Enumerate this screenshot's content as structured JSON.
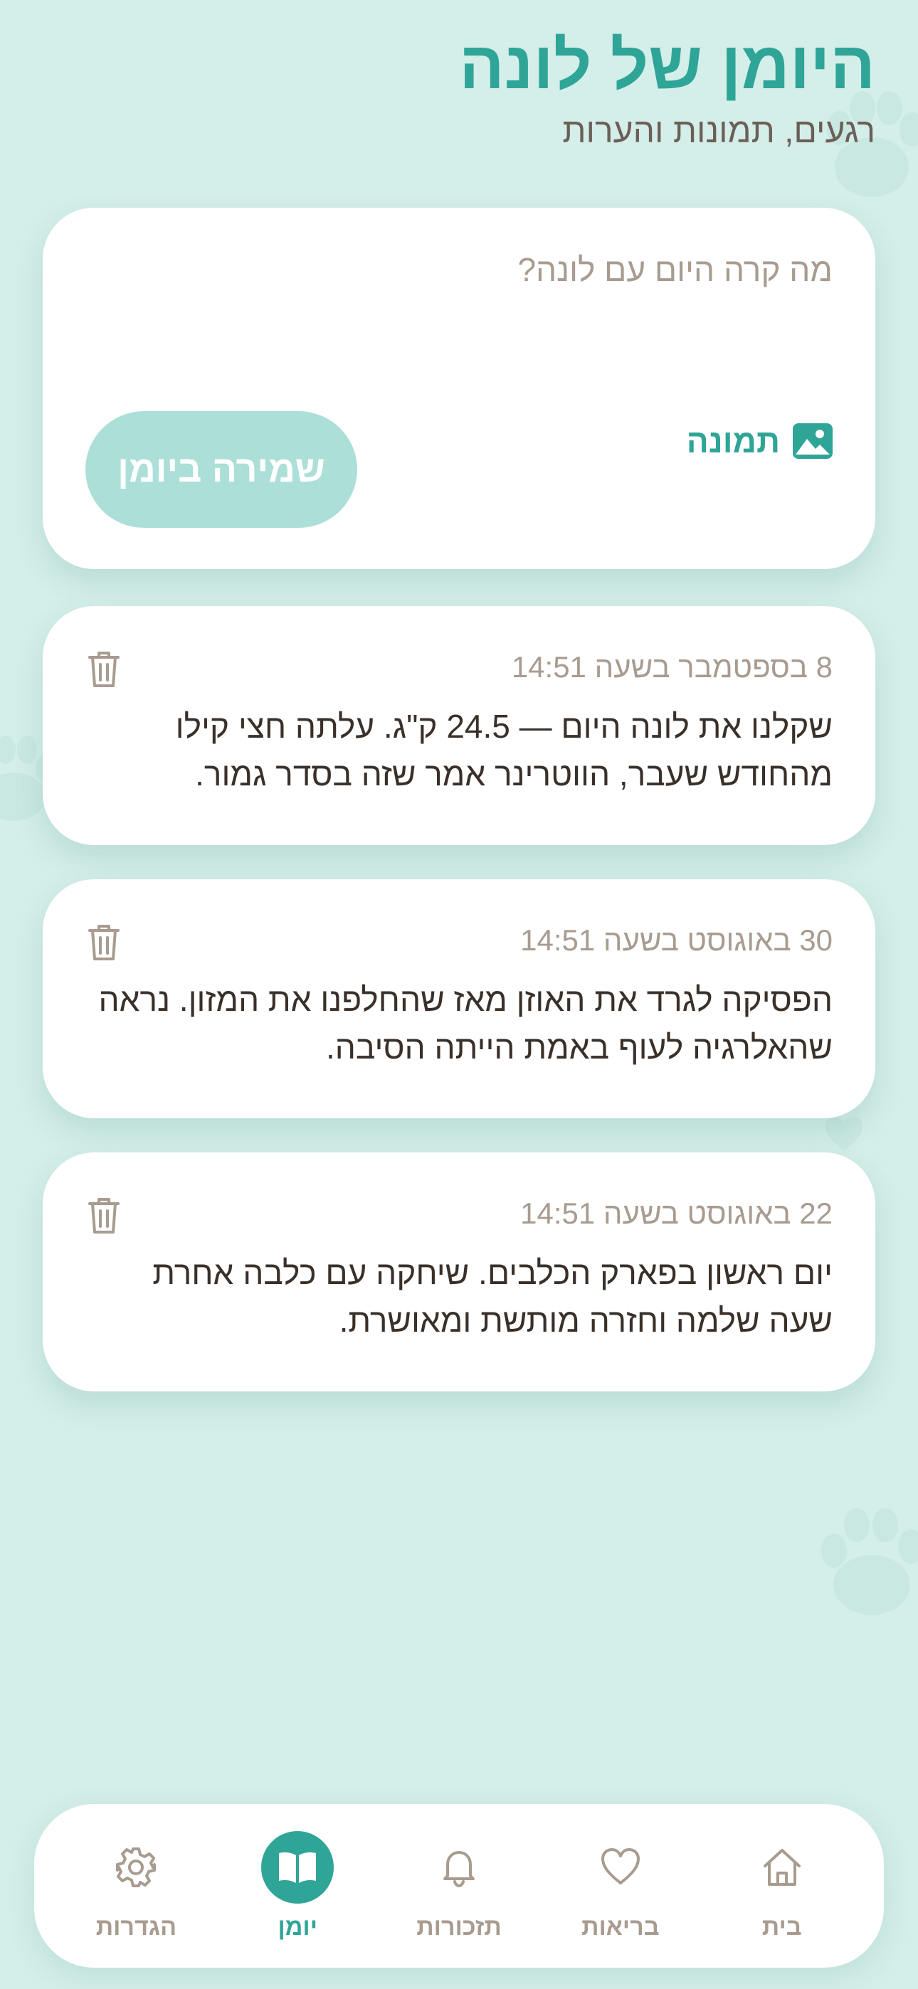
{
  "header": {
    "title": "היומן של לונה",
    "subtitle": "רגעים, תמונות והערות"
  },
  "composer": {
    "placeholder": "מה קרה היום עם לונה?",
    "photo_label": "תמונה",
    "save_label": "שמירה ביומן"
  },
  "entries": [
    {
      "date": "8 בספטמבר בשעה 14:51",
      "text": "שקלנו את לונה היום — 24.5 ק\"ג. עלתה חצי קילו מהחודש שעבר, הווטרינר אמר שזה בסדר גמור."
    },
    {
      "date": "30 באוגוסט בשעה 14:51",
      "text": "הפסיקה לגרד את האוזן מאז שהחלפנו את המזון. נראה שהאלרגיה לעוף באמת הייתה הסיבה."
    },
    {
      "date": "22 באוגוסט בשעה 14:51",
      "text": "יום ראשון בפארק הכלבים. שיחקה עם כלבה אחרת שעה שלמה וחזרה מותשת ומאושרת."
    }
  ],
  "nav": {
    "items": [
      {
        "label": "בית",
        "icon": "home-icon",
        "active": false
      },
      {
        "label": "בריאות",
        "icon": "heart-icon",
        "active": false
      },
      {
        "label": "תזכורות",
        "icon": "bell-icon",
        "active": false
      },
      {
        "label": "יומן",
        "icon": "book-icon",
        "active": true
      },
      {
        "label": "הגדרות",
        "icon": "gear-icon",
        "active": false
      }
    ]
  },
  "colors": {
    "background": "#d4eee9",
    "accent": "#2fa597",
    "save_button": "#addfd9",
    "muted_text": "#a89b8f",
    "body_text": "#3a302a"
  }
}
